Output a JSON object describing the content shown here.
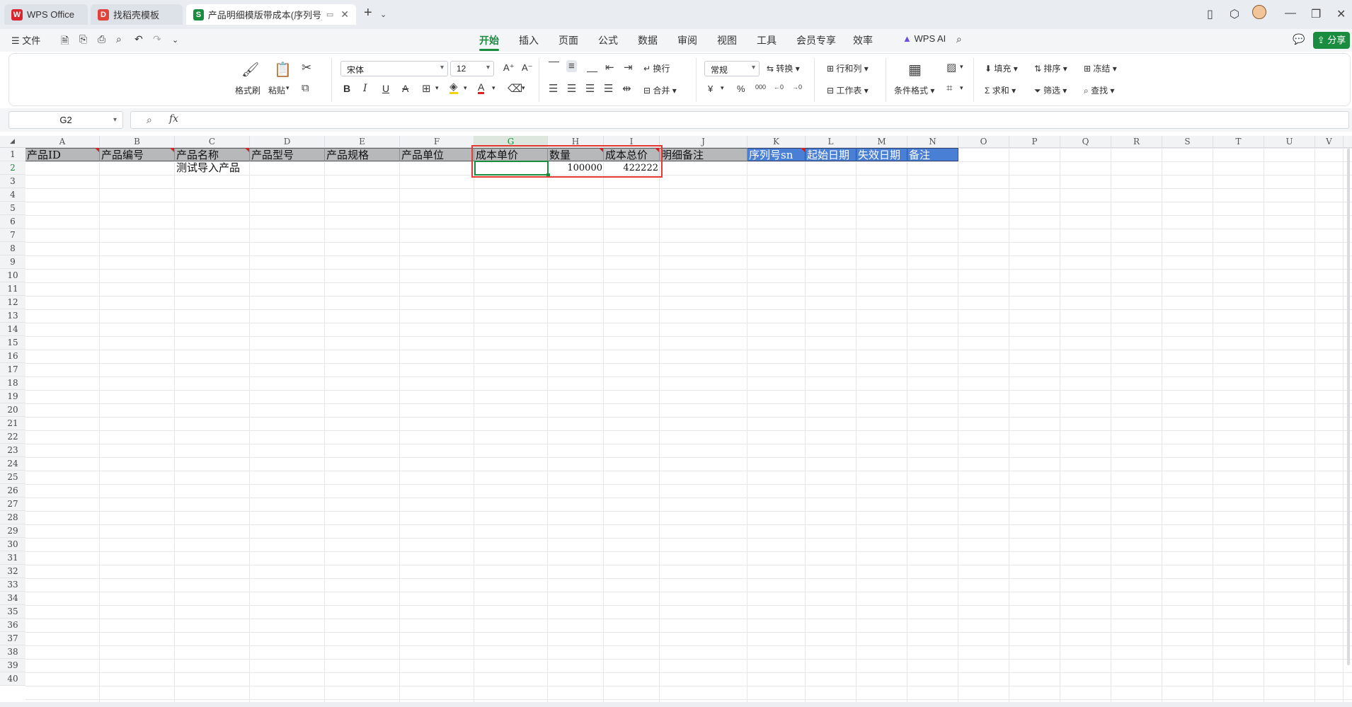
{
  "tabs": [
    {
      "label": "WPS Office",
      "icon": "wps-logo-icon",
      "active": false
    },
    {
      "label": "找稻壳模板",
      "icon": "docer-logo-icon",
      "active": false
    },
    {
      "label": "产品明细模版带成本(序列号).x",
      "icon": "spreadsheet-s-icon",
      "active": true
    }
  ],
  "menu": {
    "file": "文件",
    "tabs": [
      "开始",
      "插入",
      "页面",
      "公式",
      "数据",
      "审阅",
      "视图",
      "工具",
      "会员专享",
      "效率"
    ],
    "active_tab": "开始",
    "wps_ai": "WPS AI",
    "share": "分享"
  },
  "ribbon": {
    "format_painter": "格式刷",
    "paste": "粘贴",
    "font_name": "宋体",
    "font_size": "12",
    "wrap": "换行",
    "merge": "合并",
    "number_format": "常规",
    "convert": "转换",
    "row_col": "行和列",
    "worksheet": "工作表",
    "cond_format": "条件格式",
    "fill": "填充",
    "sort": "排序",
    "freeze": "冻结",
    "sum": "求和",
    "filter": "筛选",
    "find": "查找",
    "bold": "B",
    "italic": "I",
    "underline": "U",
    "strike": "A",
    "font_color": "A",
    "currency": "¥",
    "percent": "%",
    "thousands": "000",
    "inc_decimal": "←0",
    "dec_decimal": "→0"
  },
  "formula_bar": {
    "name_box": "G2",
    "fx": "fx",
    "value": ""
  },
  "grid": {
    "columns": [
      "A",
      "B",
      "C",
      "D",
      "E",
      "F",
      "G",
      "H",
      "I",
      "J",
      "K",
      "L",
      "M",
      "N",
      "O",
      "P",
      "Q",
      "R",
      "S",
      "T",
      "U",
      "V"
    ],
    "selected_column": "G",
    "rows": [
      "1",
      "2",
      "3",
      "4",
      "5",
      "6",
      "7",
      "8",
      "9",
      "10",
      "11",
      "12",
      "13",
      "14",
      "15",
      "16",
      "17",
      "18",
      "19",
      "20",
      "21",
      "22",
      "23",
      "24",
      "25",
      "26",
      "27",
      "28",
      "29",
      "30",
      "31",
      "32",
      "33",
      "34",
      "35",
      "36",
      "37",
      "38",
      "39",
      "40"
    ],
    "selected_row": "2",
    "header_row": [
      "产品ID",
      "产品编号",
      "产品名称",
      "产品型号",
      "产品规格",
      "产品单位",
      "成本单价",
      "数量",
      "成本总价",
      "明细备注",
      "序列号sn",
      "起始日期",
      "失效日期",
      "备注"
    ],
    "row2": {
      "C": "测试导入产品",
      "H": "100000",
      "I": "422222"
    },
    "colors": {
      "header_gray": "#b7b8ba",
      "header_blue": "#4a7fd6",
      "selection_green": "#1a8c3f",
      "highlight_red": "#e53935"
    }
  }
}
